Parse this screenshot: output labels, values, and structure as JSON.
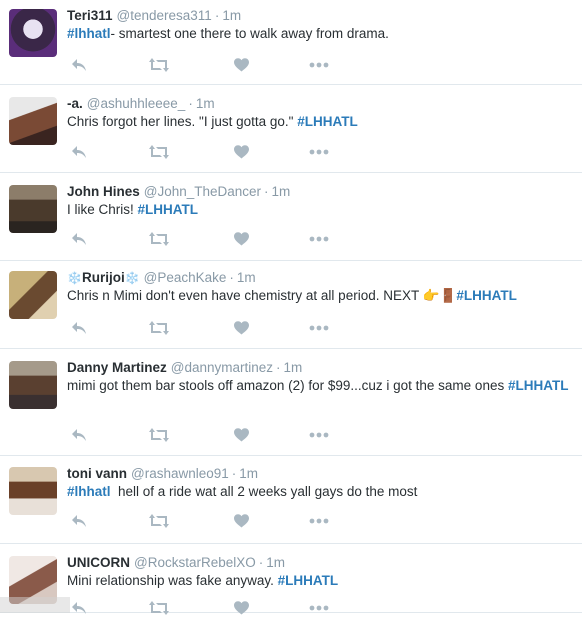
{
  "icons": {
    "reply": "reply-icon",
    "retweet": "retweet-icon",
    "like": "heart-icon",
    "more": "more-icon"
  },
  "colors": {
    "hashtag": "#2b7bb9",
    "meta": "#8899a6",
    "icon": "#aab8c2",
    "divider": "#e1e8ed"
  },
  "tweets": [
    {
      "name": "Teri311",
      "handle": "@tenderesa311",
      "time": "1m",
      "parts": [
        {
          "tag": "#lhhatl"
        },
        {
          "text": "- smartest one there to walk away from drama."
        }
      ]
    },
    {
      "name": "-a.",
      "handle": "@ashuhhleeee_",
      "time": "1m",
      "parts": [
        {
          "text": "Chris forgot her lines. \"I just gotta go.\" "
        },
        {
          "tag": "#LHHATL"
        }
      ]
    },
    {
      "name": "John Hines",
      "handle": "@John_TheDancer",
      "time": "1m",
      "parts": [
        {
          "text": "I like Chris! "
        },
        {
          "tag": "#LHHATL"
        }
      ]
    },
    {
      "name": "Rurijoi",
      "name_prefix": "❄️",
      "name_suffix": "❄️",
      "handle": "@PeachKake",
      "time": "1m",
      "parts": [
        {
          "text": "Chris n Mimi don't even have chemistry at all period. NEXT "
        },
        {
          "emoji": "👉"
        },
        {
          "emoji": "🚪"
        },
        {
          "tag": "#LHHATL"
        }
      ]
    },
    {
      "name": "Danny Martinez",
      "handle": "@dannymartinez",
      "time": "1m",
      "parts": [
        {
          "text": "mimi got them bar stools off amazon (2) for $99...cuz i got the same ones "
        },
        {
          "tag": "#LHHATL"
        }
      ]
    },
    {
      "name": "toni vann",
      "handle": "@rashawnleo91",
      "time": "1m",
      "parts": [
        {
          "tag": "#lhhatl"
        },
        {
          "text": "  hell of a ride wat all 2 weeks yall gays do the most"
        }
      ]
    },
    {
      "name": "UNICORN",
      "handle": "@RockstarRebelXO",
      "time": "1m",
      "parts": [
        {
          "text": "Mini relationship was fake anyway. "
        },
        {
          "tag": "#LHHATL"
        }
      ]
    }
  ]
}
